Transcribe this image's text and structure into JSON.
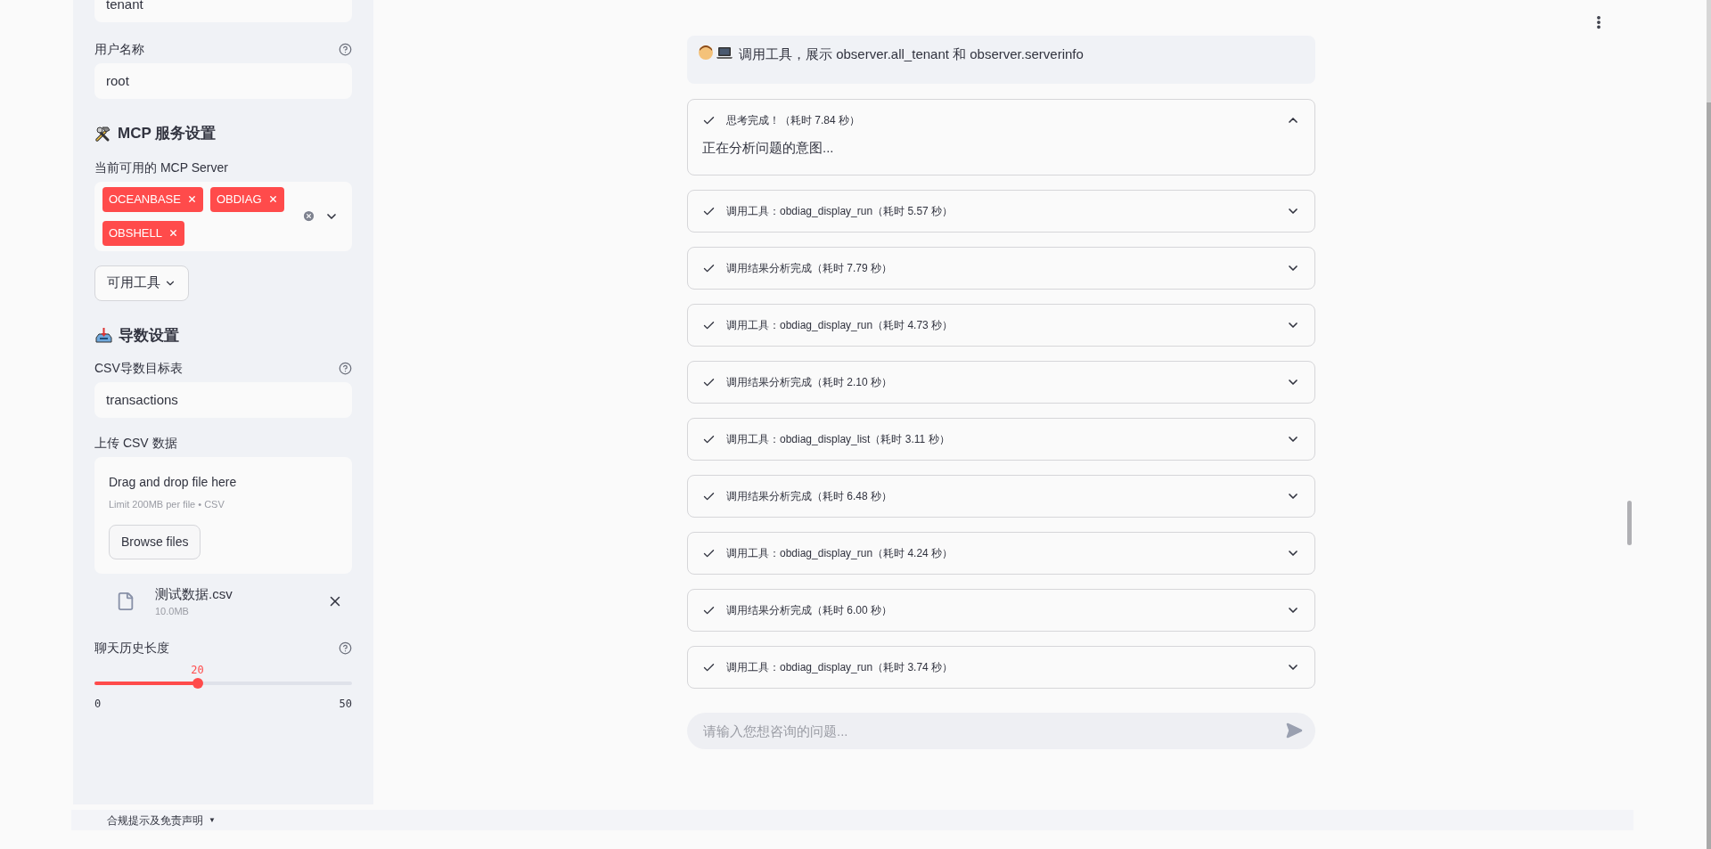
{
  "sidebar": {
    "fields_top": [
      {
        "kind": "input",
        "value": "tenant"
      },
      {
        "kind": "labeled",
        "label": "用户名称",
        "value": "root",
        "help": true
      }
    ],
    "mcp_section": {
      "heading": "MCP 服务设置",
      "select_label": "当前可用的 MCP Server",
      "tags": [
        "OCEANBASE",
        "OBDIAG",
        "OBSHELL"
      ],
      "tools_button": "可用工具"
    },
    "export_section": {
      "heading": "导数设置",
      "table_label": "CSV导数目标表",
      "table_value": "transactions",
      "table_help": true,
      "upload_label": "上传 CSV 数据",
      "drop_title": "Drag and drop file here",
      "drop_hint": "Limit 200MB per file • CSV",
      "browse_button": "Browse files",
      "file_name": "测试数据.csv",
      "file_size": "10.0MB"
    },
    "history_slider": {
      "label": "聊天历史长度",
      "help": true,
      "value": "20",
      "level": 0.4,
      "min": "0",
      "max": "50"
    }
  },
  "chat": {
    "user_message": "调用工具，展示 observer.all_tenant 和 observer.serverinfo",
    "steps": [
      {
        "title": "思考完成！（耗时 7.84 秒）",
        "expanded": true,
        "body": "正在分析问题的意图..."
      },
      {
        "title": "调用工具：obdiag_display_run（耗时 5.57 秒）",
        "expanded": false
      },
      {
        "title": "调用结果分析完成（耗时 7.79 秒）",
        "expanded": false
      },
      {
        "title": "调用工具：obdiag_display_run（耗时 4.73 秒）",
        "expanded": false
      },
      {
        "title": "调用结果分析完成（耗时 2.10 秒）",
        "expanded": false
      },
      {
        "title": "调用工具：obdiag_display_list（耗时 3.11 秒）",
        "expanded": false
      },
      {
        "title": "调用结果分析完成（耗时 6.48 秒）",
        "expanded": false
      },
      {
        "title": "调用工具：obdiag_display_run（耗时 4.24 秒）",
        "expanded": false
      },
      {
        "title": "调用结果分析完成（耗时 6.00 秒）",
        "expanded": false
      },
      {
        "title": "调用工具：obdiag_display_run（耗时 3.74 秒）",
        "expanded": false
      }
    ],
    "input_placeholder": "请输入您想咨询的问题..."
  },
  "footer": {
    "disclaimer": "合规提示及免责声明",
    "caret": "▼"
  }
}
